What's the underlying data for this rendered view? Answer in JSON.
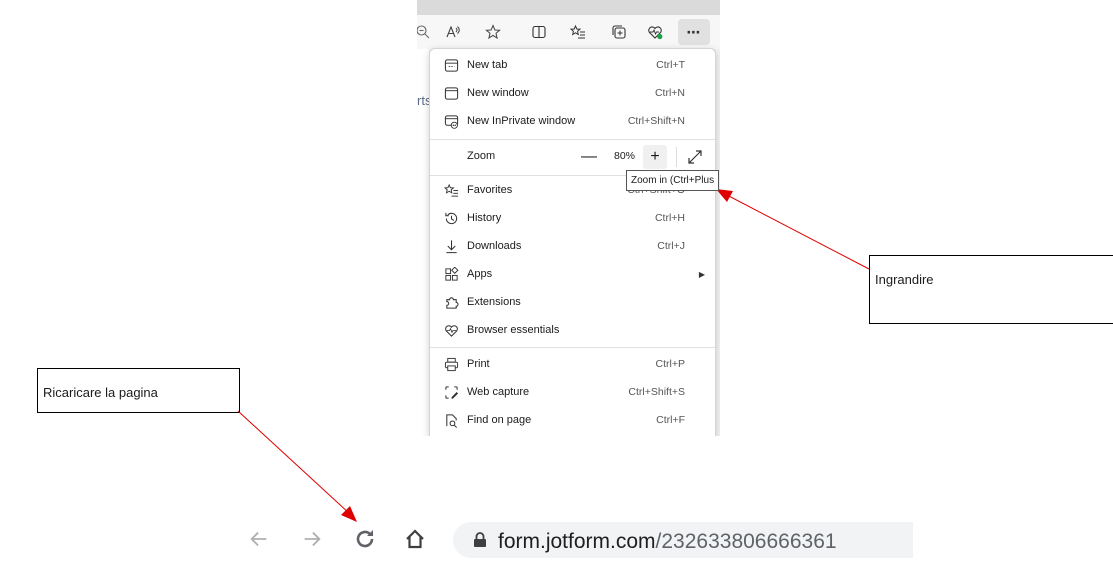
{
  "browser_menu": {
    "zoom": {
      "label": "Zoom",
      "minus": "—",
      "value": "80%",
      "plus": "+"
    },
    "items": [
      {
        "label": "New tab",
        "shortcut": "Ctrl+T",
        "icon": "new-tab-icon"
      },
      {
        "label": "New window",
        "shortcut": "Ctrl+N",
        "icon": "new-window-icon"
      },
      {
        "label": "New InPrivate window",
        "shortcut": "Ctrl+Shift+N",
        "icon": "inprivate-icon"
      },
      {
        "label": "Favorites",
        "shortcut": "Ctrl+Shift+O",
        "icon": "favorites-icon"
      },
      {
        "label": "History",
        "shortcut": "Ctrl+H",
        "icon": "history-icon"
      },
      {
        "label": "Downloads",
        "shortcut": "Ctrl+J",
        "icon": "download-icon"
      },
      {
        "label": "Apps",
        "shortcut": "",
        "icon": "apps-icon"
      },
      {
        "label": "Extensions",
        "shortcut": "",
        "icon": "extensions-icon"
      },
      {
        "label": "Browser essentials",
        "shortcut": "",
        "icon": "heart-pulse-icon"
      },
      {
        "label": "Print",
        "shortcut": "Ctrl+P",
        "icon": "printer-icon"
      },
      {
        "label": "Web capture",
        "shortcut": "Ctrl+Shift+S",
        "icon": "web-capture-icon"
      },
      {
        "label": "Find on page",
        "shortcut": "Ctrl+F",
        "icon": "find-icon"
      }
    ]
  },
  "page_fragment": "rts",
  "tooltip": "Zoom in (Ctrl+Plus",
  "callouts": {
    "zoom": "Ingrandire",
    "reload": "Ricaricare la pagina"
  },
  "address_bar": {
    "url_host": "form.jotform.com",
    "url_path": "/232633806666361"
  },
  "colors": {
    "arrow": "#e00000",
    "accent_dot": "#1aa34a"
  }
}
